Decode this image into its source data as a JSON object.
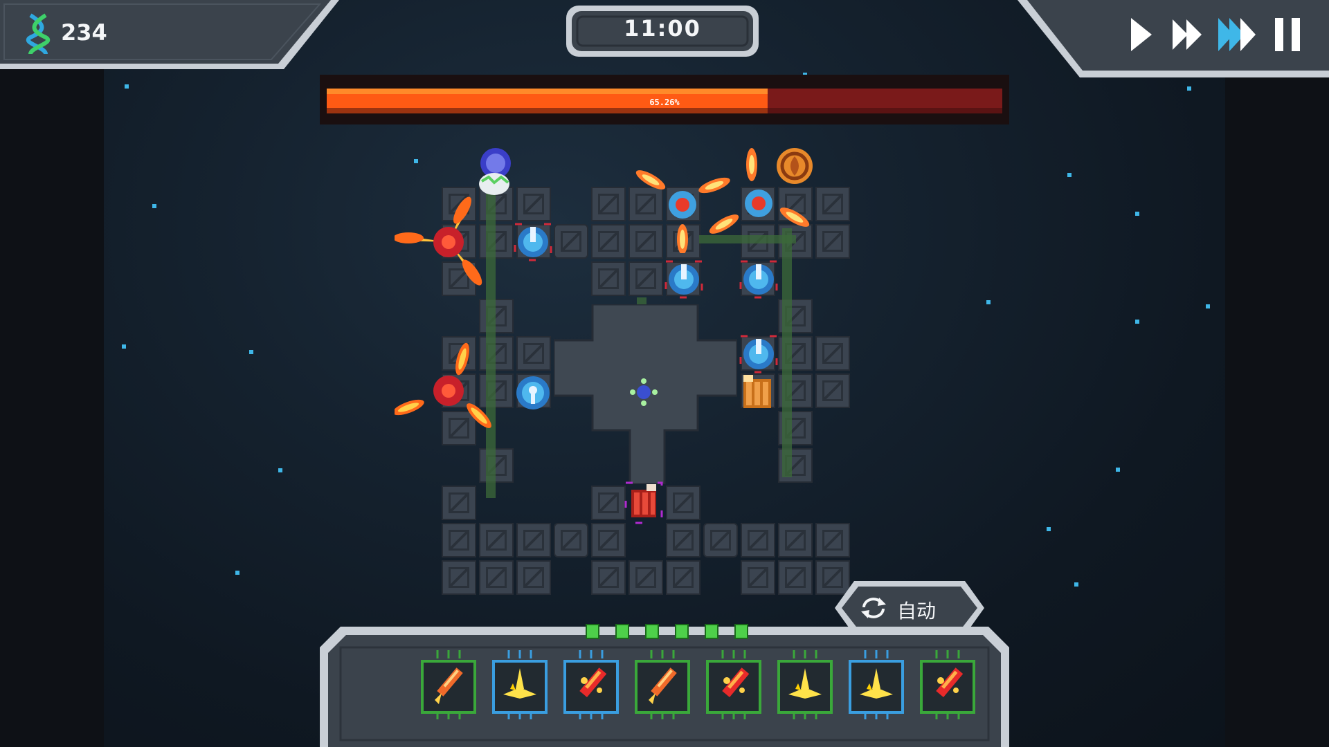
{
  "hud": {
    "dna_icon": "dna-icon",
    "dna_count": "234",
    "timer": "11:00",
    "speed_buttons": [
      {
        "name": "play",
        "icon": "play-icon",
        "active": false
      },
      {
        "name": "fast-forward",
        "icon": "fast-forward-icon",
        "active": false
      },
      {
        "name": "fastest",
        "icon": "fastest-icon",
        "active": true
      },
      {
        "name": "pause",
        "icon": "pause-icon",
        "active": false
      }
    ]
  },
  "wave_progress": {
    "label": "65.26%",
    "fraction": 0.6526,
    "fill_color": "#ff5a14",
    "track_color": "#7a1a1a"
  },
  "auto_button": {
    "icon": "refresh-icon",
    "label": "自动"
  },
  "tray": {
    "slots_lit": 6,
    "cards": [
      {
        "name": "rocket-card",
        "frame": "green",
        "icon": "rocket-icon"
      },
      {
        "name": "spike-card",
        "frame": "blue",
        "icon": "spike-icon"
      },
      {
        "name": "fire-rocket-card",
        "frame": "blue",
        "icon": "fire-rocket-icon"
      },
      {
        "name": "rocket-card",
        "frame": "green",
        "icon": "rocket-icon"
      },
      {
        "name": "fire-rocket-card",
        "frame": "green",
        "icon": "fire-rocket-icon"
      },
      {
        "name": "spike-card",
        "frame": "green",
        "icon": "spike-icon"
      },
      {
        "name": "spike-card",
        "frame": "blue",
        "icon": "spike-icon"
      },
      {
        "name": "fire-rocket-card",
        "frame": "green",
        "icon": "fire-rocket-icon"
      }
    ]
  },
  "colors": {
    "panel": "#3b434c",
    "panel_border": "#c9cfd6",
    "accent_cyan": "#3fb7e8",
    "fire": "#ff9a1a"
  }
}
